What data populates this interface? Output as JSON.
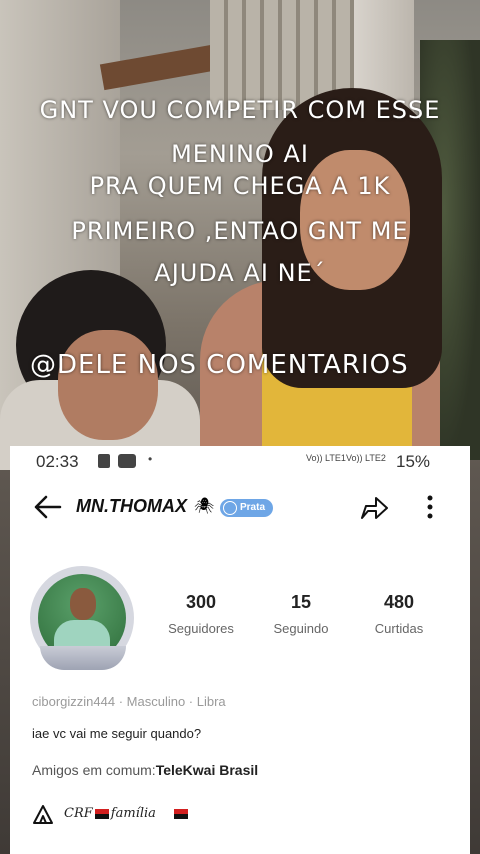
{
  "overlay": {
    "line1": "GNT VOU COMPETIR COM ESSE",
    "line2": "MENINO AI",
    "line3": "PRA QUEM CHEGA A 1K",
    "line4": "PRIMEIRO ,ENTAO GNT ME",
    "line5": "AJUDA AI NE´",
    "line6": "@DELE NOS COMENTARIOS"
  },
  "status_bar": {
    "time": "02:33",
    "signal1": "Vo)) LTE1",
    "signal2": "Vo)) LTE2",
    "battery": "15%"
  },
  "profile": {
    "username": "MN.THOMAX",
    "badge": "Prata",
    "stats": [
      {
        "value": "300",
        "label": "Seguidores"
      },
      {
        "value": "15",
        "label": "Seguindo"
      },
      {
        "value": "480",
        "label": "Curtidas"
      }
    ],
    "meta": "ciborgizzin444  ·  Masculino  ·  Libra",
    "bio": "iae vc vai me seguir quando?",
    "friends_label": "Amigos em comum:",
    "friends_value": "TeleKwai Brasil",
    "family_text_a": "CRF",
    "family_text_b": "família"
  },
  "colors": {
    "badge": "#6ea6e6",
    "card_bg": "#ffffff"
  },
  "icons": [
    "back-arrow-icon",
    "share-icon",
    "more-vert-icon",
    "spider-icon",
    "tent-icon"
  ]
}
